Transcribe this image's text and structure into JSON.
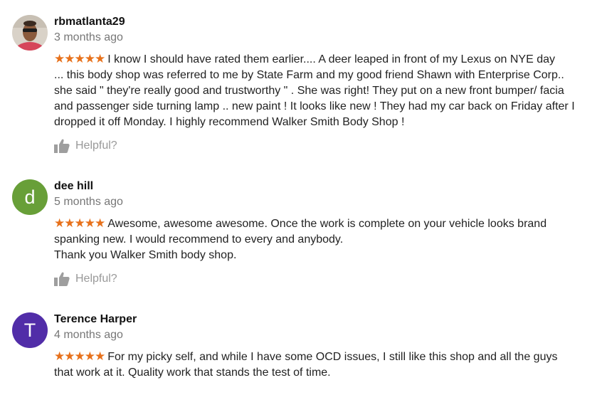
{
  "reviews": [
    {
      "author": "rbmatlanta29",
      "date": "3 months ago",
      "stars": "★★★★★",
      "text_lines": [
        "I know I should have rated them earlier.... A deer leaped in front of my Lexus on NYE day",
        "... this body shop was referred to me by State Farm and my good friend Shawn with Enterprise Corp..",
        "she said \" they're really good and trustworthy \" . She was right! They put on a new front bumper/ facia",
        "and passenger side turning lamp .. new paint ! It looks like new ! They had my car back on Friday after I",
        "dropped it off Monday. I highly recommend Walker Smith Body Shop !"
      ],
      "helpful_label": "Helpful?"
    },
    {
      "author": "dee hill",
      "date": "5 months ago",
      "avatar_letter": "d",
      "avatar_color": "#689f38",
      "stars": "★★★★★",
      "text_lines": [
        "Awesome, awesome awesome. Once the work is complete on your vehicle looks brand",
        "spanking new. I would recommend to every and anybody.",
        "Thank you Walker Smith body shop."
      ],
      "helpful_label": "Helpful?"
    },
    {
      "author": "Terence Harper",
      "date": "4 months ago",
      "avatar_letter": "T",
      "avatar_color": "#512da8",
      "stars": "★★★★★",
      "text_lines": [
        "For my picky self,  and while I have some OCD issues, I still like this shop and all the guys",
        "that work at it. Quality work that stands the test of time."
      ]
    }
  ],
  "colors": {
    "star": "#e7711b",
    "helpful_text": "#999999",
    "date_text": "#777777"
  },
  "icons": {
    "helpful": "thumbs-up-icon"
  }
}
